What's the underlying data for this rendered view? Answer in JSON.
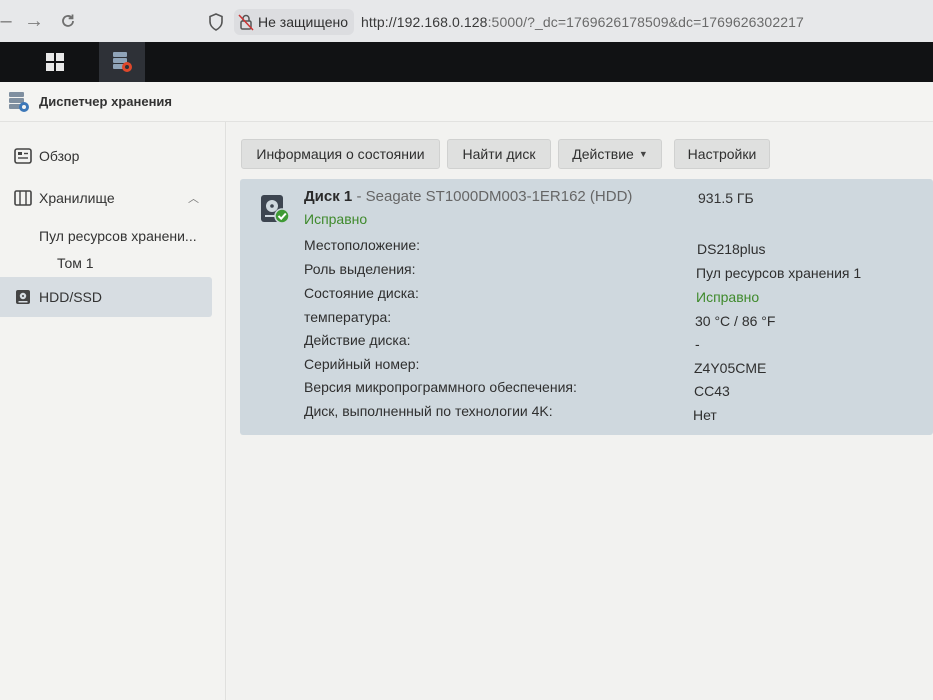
{
  "browser": {
    "security_label": "Не защищено",
    "url_host": "http://192.168.0.128",
    "url_rest": ":5000/?_dc=1769626178509&dc=1769626302217"
  },
  "window": {
    "title": "Диспетчер хранения"
  },
  "sidebar": {
    "items": [
      {
        "label": "Обзор",
        "icon": "overview-icon"
      },
      {
        "label": "Хранилище",
        "icon": "storage-icon"
      },
      {
        "label": "HDD/SSD",
        "icon": "hdd-icon"
      }
    ],
    "pool_label": "Пул ресурсов хранени...",
    "volume_label": "Том 1"
  },
  "toolbar": {
    "info_label": "Информация о состоянии",
    "find_label": "Найти диск",
    "action_label": "Действие",
    "settings_label": "Настройки"
  },
  "disk": {
    "name": "Диск 1",
    "separator": " - ",
    "model": "Seagate ST1000DM003-1ER162 (HDD)",
    "size": "931.5 ГБ",
    "status": "Исправно",
    "details": [
      {
        "label": "Местоположение:",
        "value": "DS218plus"
      },
      {
        "label": "Роль выделения:",
        "value": "Пул ресурсов хранения 1"
      },
      {
        "label": "Состояние диска:",
        "value": "Исправно"
      },
      {
        "label": "температура:",
        "value": "30 °C / 86 °F"
      },
      {
        "label": "Действие диска:",
        "value": "-"
      },
      {
        "label": "Серийный номер:",
        "value": "Z4Y05CME"
      },
      {
        "label": "Версия микропрограммного обеспечения:",
        "value": "CC43"
      },
      {
        "label": "Диск, выполненный по технологии 4K:",
        "value": "Нет"
      }
    ]
  },
  "colors": {
    "healthy": "#3f8a2c",
    "panel": "#cfd8de",
    "selected": "#d7dde2",
    "taskbar": "#111214"
  }
}
